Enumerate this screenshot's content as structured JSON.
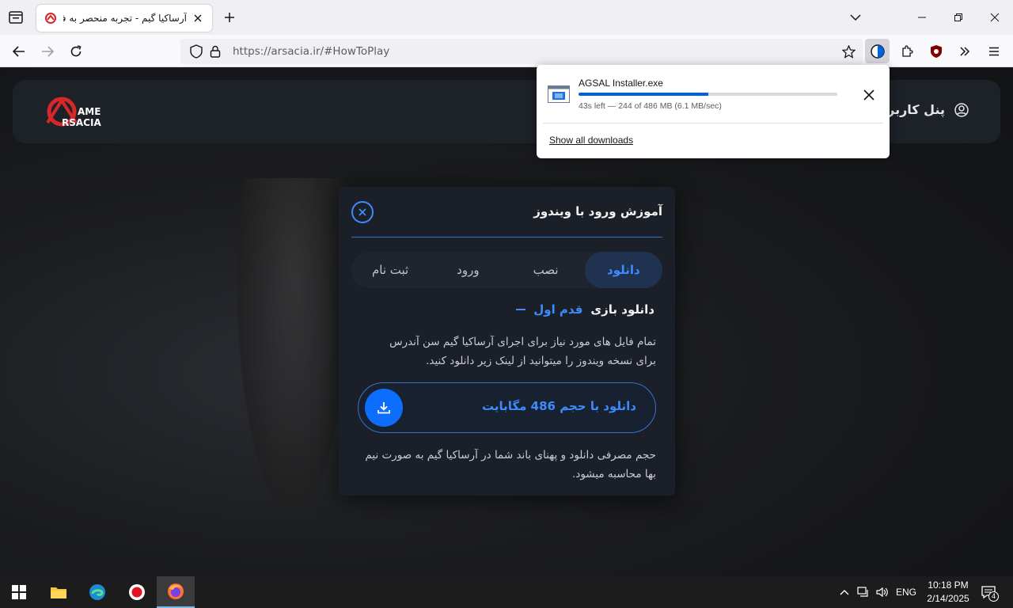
{
  "browser": {
    "tab_title": "آرساکیا گیم - تجربه منحصر به فرد",
    "url_host": "https://arsacia.ir/",
    "url_path": "#HowToPlay"
  },
  "downloads": {
    "file_name": "AGSAL Installer.exe",
    "status": "43s left — 244 of 486 MB (6.1 MB/sec)",
    "progress_fraction": 0.502,
    "show_all": "Show all downloads"
  },
  "site": {
    "logo_line1": "AME",
    "logo_line2": "RSACIA",
    "user_panel": "پنل کاربری"
  },
  "modal": {
    "title": "آموزش ورود با ویندوز",
    "tabs": [
      "دانلود",
      "نصب",
      "ورود",
      "ثبت نام"
    ],
    "active_tab": 0,
    "step_label": "قدم اول",
    "step_title": "دانلود بازی",
    "description": "تمام فایل های مورد نیاز برای اجرای آرساکیا گیم سن آندرس برای نسخه ویندوز را میتوانید از لینک زیر دانلود کنید.",
    "download_button": "دانلود با حجم 486 مگابایت",
    "note": "حجم مصرفی دانلود و پهنای باند شما در آرساکیا گیم به صورت نیم بها محاسبه میشود."
  },
  "taskbar": {
    "language": "ENG",
    "time": "10:18 PM",
    "date": "2/14/2025",
    "notification_count": "4"
  },
  "colors": {
    "accent": "#3d8bfd",
    "firefox_progress": "#0061e0",
    "modal_bg": "#1b1f27"
  }
}
